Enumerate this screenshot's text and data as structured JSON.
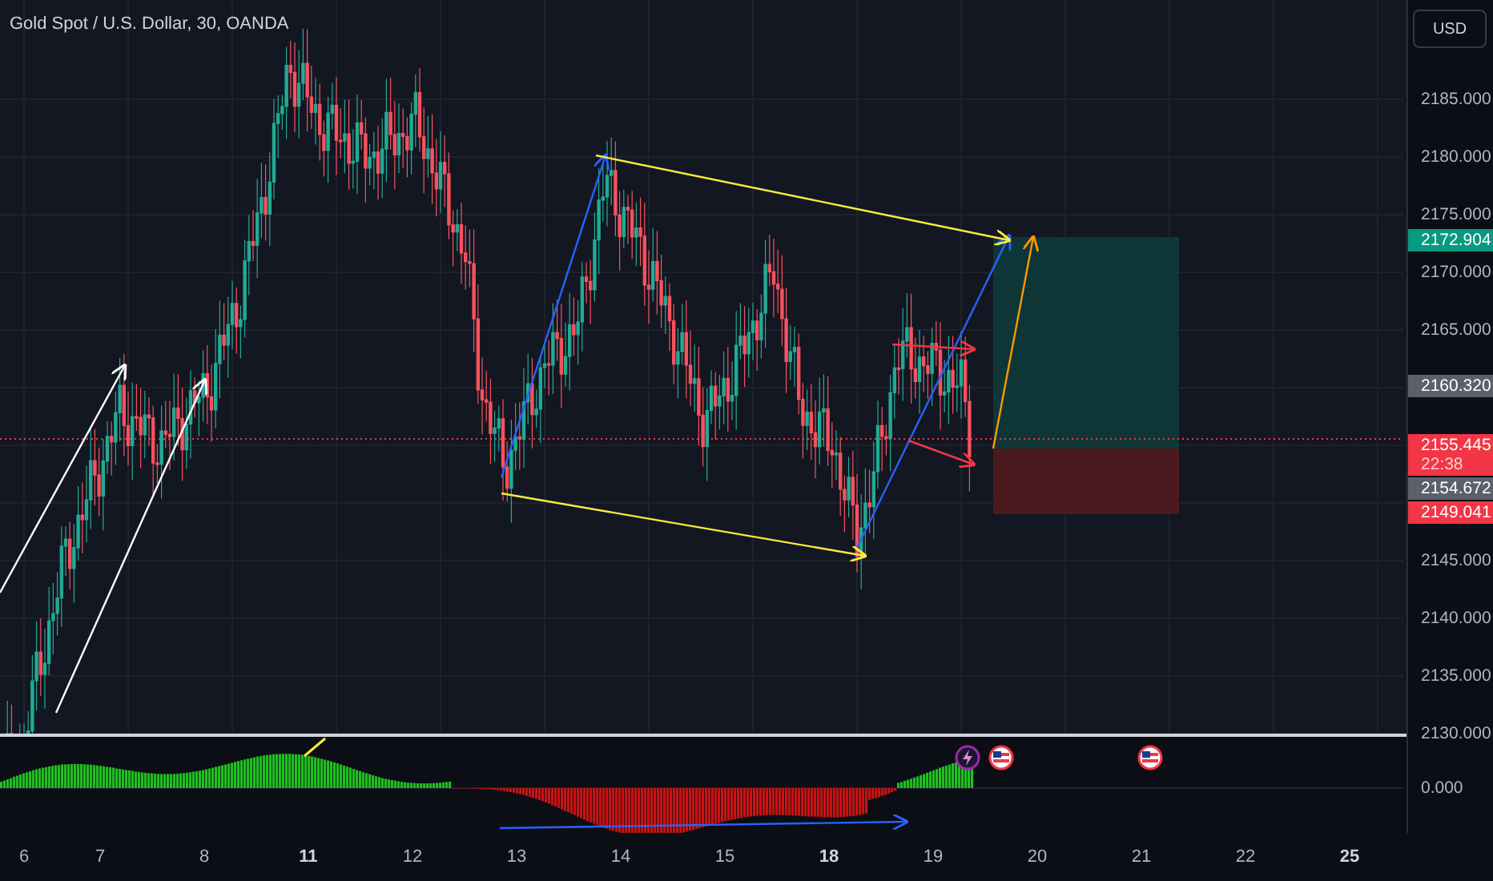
{
  "chart_title": "Gold Spot / U.S. Dollar, 30, OANDA",
  "currency_button": "USD",
  "price_scale_upper": [
    "2185.000",
    "2180.000",
    "2175.000",
    "2170.000",
    "2165.000"
  ],
  "price_scale_lower": [
    "2145.000",
    "2140.000",
    "2135.000",
    "2130.000"
  ],
  "price_tags": [
    {
      "label": "2172.904",
      "kind": "target"
    },
    {
      "label": "2160.320",
      "kind": "marker"
    },
    {
      "label": "2155.445",
      "kind": "last",
      "countdown": "22:38"
    },
    {
      "label": "2154.672",
      "kind": "marker"
    },
    {
      "label": "2149.041",
      "kind": "stop"
    }
  ],
  "events": [
    {
      "kind": "flash"
    },
    {
      "kind": "flag"
    },
    {
      "kind": "flag"
    }
  ],
  "indicator_scale": "0.000",
  "time_axis": [
    {
      "label": "6",
      "emphasized": false
    },
    {
      "label": "7",
      "emphasized": false
    },
    {
      "label": "8",
      "emphasized": false
    },
    {
      "label": "11",
      "emphasized": true
    },
    {
      "label": "12",
      "emphasized": false
    },
    {
      "label": "13",
      "emphasized": false
    },
    {
      "label": "14",
      "emphasized": false
    },
    {
      "label": "15",
      "emphasized": false
    },
    {
      "label": "18",
      "emphasized": true
    },
    {
      "label": "19",
      "emphasized": false
    },
    {
      "label": "20",
      "emphasized": false
    },
    {
      "label": "21",
      "emphasized": false
    },
    {
      "label": "22",
      "emphasized": false
    },
    {
      "label": "25",
      "emphasized": true
    }
  ]
}
